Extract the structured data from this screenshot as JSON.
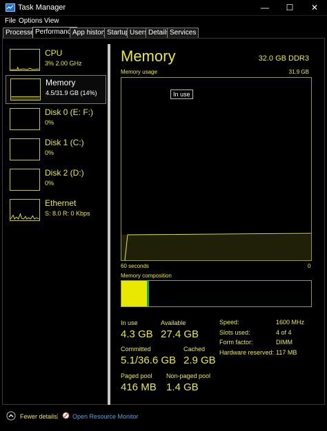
{
  "window": {
    "title": "Task Manager"
  },
  "menu": [
    "File",
    "Options",
    "View"
  ],
  "tabs": [
    "Processes",
    "Performance",
    "App history",
    "Startup",
    "Users",
    "Details",
    "Services"
  ],
  "sidebar": {
    "items": [
      {
        "name": "CPU",
        "detail": "3%  2.00 GHz"
      },
      {
        "name": "Memory",
        "detail": "4.5/31.9 GB (14%)"
      },
      {
        "name": "Disk 0 (E: F:)",
        "detail": "0%"
      },
      {
        "name": "Disk 1 (C:)",
        "detail": "0%"
      },
      {
        "name": "Disk 2 (D:)",
        "detail": "0%"
      },
      {
        "name": "Ethernet",
        "detail": "S: 8.0  R: 0 Kbps"
      }
    ]
  },
  "memory": {
    "title": "Memory",
    "spec": "32.0 GB DDR3",
    "usage_label": "Memory usage",
    "usage_max": "31.9 GB",
    "tooltip": "In use",
    "time_label": "60 seconds",
    "time_end": "0",
    "composition_label": "Memory composition",
    "composition": {
      "in_use_fraction": 0.135,
      "modified_fraction": 0.01
    }
  },
  "stats": {
    "in_use_label": "In use",
    "in_use": "4.3 GB",
    "available_label": "Available",
    "available": "27.4 GB",
    "committed_label": "Committed",
    "committed": "5.1/36.6 GB",
    "cached_label": "Cached",
    "cached": "2.9 GB",
    "paged_pool_label": "Paged pool",
    "paged_pool": "416 MB",
    "nonpaged_pool_label": "Non-paged pool",
    "nonpaged_pool": "1.4 GB"
  },
  "specs": [
    {
      "label": "Speed:",
      "value": "1600 MHz"
    },
    {
      "label": "Slots used:",
      "value": "4 of 4"
    },
    {
      "label": "Form factor:",
      "value": "DIMM"
    },
    {
      "label": "Hardware reserved:",
      "value": "117 MB"
    }
  ],
  "footer": {
    "fewer_details": "Fewer details",
    "separator": "|",
    "resource_monitor": "Open Resource Monitor"
  },
  "colors": {
    "accent": "#e8e84a",
    "fill": "#e8e800",
    "modified": "#1aa64c",
    "link": "#5aa0e8"
  },
  "icons": [
    "task-manager-icon",
    "minimize-icon",
    "maximize-icon",
    "close-icon",
    "chevron-up-icon",
    "resource-monitor-icon"
  ]
}
